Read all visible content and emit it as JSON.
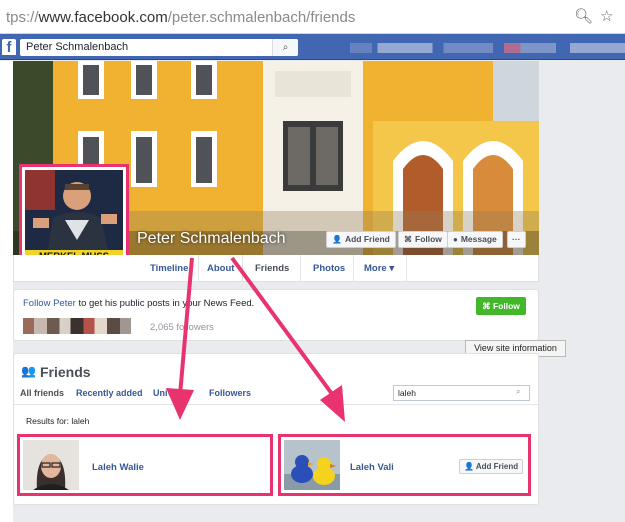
{
  "browser": {
    "url_prefix": "tps://",
    "url_domain": "www.facebook.com",
    "url_path": "/peter.schmalenbach/friends",
    "search_icon": "magnifier-icon",
    "bookmark_icon": "star-icon"
  },
  "fb_header": {
    "logo": "f",
    "search_value": "Peter Schmalenbach",
    "search_button": "🔍"
  },
  "profile": {
    "name": "Peter Schmalenbach",
    "picture_banner": "MERKEL MUSS WEG!",
    "cover_buttons": {
      "add_friend": "Add Friend",
      "follow": "Follow",
      "message": "Message",
      "more": "···"
    }
  },
  "tabs": {
    "timeline": "Timeline",
    "about": "About",
    "friends": "Friends",
    "photos": "Photos",
    "more": "More ▾"
  },
  "follow_box": {
    "link": "Follow Peter",
    "text": " to get his public posts in your News Feed.",
    "followers": "2,065 followers",
    "follow_button": "Follow"
  },
  "tooltip": "View site information",
  "friends_section": {
    "title": "Friends",
    "tabs": [
      "All friends",
      "Recently added",
      "Univ",
      "Followers"
    ],
    "search_value": "laleh",
    "results_text": "Results for: laleh"
  },
  "results": [
    {
      "name": "Laleh Walie",
      "action": ""
    },
    {
      "name": "Laleh Vali",
      "action": "Add Friend"
    }
  ],
  "colors": {
    "fb_blue": "#4267b2",
    "link_blue": "#365899",
    "highlight_pink": "#e8336f",
    "follow_green": "#42b72a"
  }
}
